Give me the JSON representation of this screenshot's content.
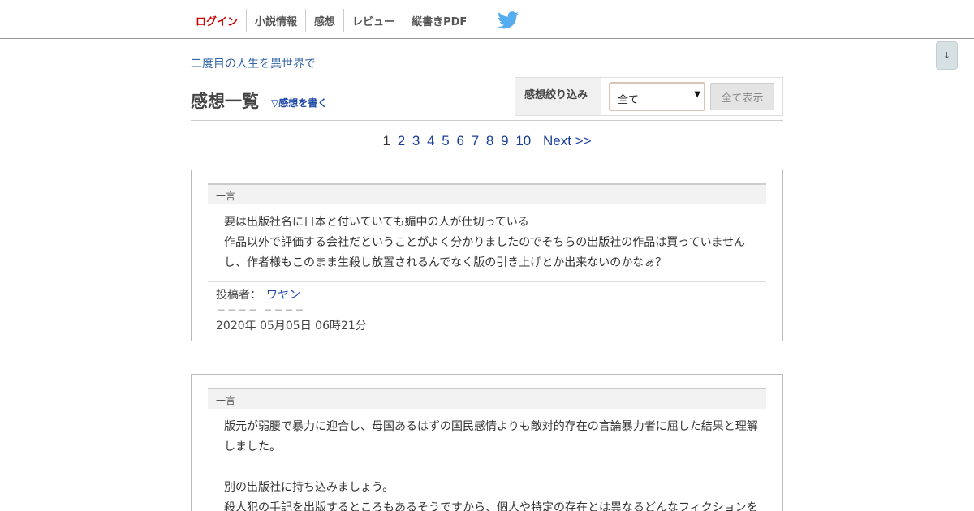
{
  "nav": {
    "items": [
      {
        "label": "ログイン",
        "kind": "login"
      },
      {
        "label": "小説情報"
      },
      {
        "label": "感想"
      },
      {
        "label": "レビュー"
      },
      {
        "label": "縦書きPDF"
      }
    ],
    "twitter_icon": "twitter-bird-icon",
    "twitter_color": "#55acee"
  },
  "scroll_button": {
    "label": "↓"
  },
  "novel_title": "二度目の人生を異世界で",
  "page": {
    "heading": "感想一覧",
    "write_link": "▽感想を書く"
  },
  "filter": {
    "label": "感想絞り込み",
    "selected": "全て",
    "button": "全て表示"
  },
  "pager": {
    "pages": [
      "1",
      "2",
      "3",
      "4",
      "5",
      "6",
      "7",
      "8",
      "9",
      "10"
    ],
    "current": "1",
    "next": "Next >>"
  },
  "comments": [
    {
      "head": "一言",
      "lines": [
        "要は出版社名に日本と付いていても媚中の人が仕切っている",
        "作品以外で評価する会社だということがよく分かりましたのでそちらの出版社の作品は買っていません",
        "し、作者様もこのまま生殺し放置されるんでなく版の引き上げとか出来ないのかなぁ？"
      ],
      "author_label": "投稿者：",
      "author": "ワヤン",
      "dashes": "－－－－ －－－－",
      "date": "2020年 05月05日 06時21分"
    },
    {
      "head": "一言",
      "lines": [
        "版元が弱腰で暴力に迎合し、母国あるはずの国民感情よりも敵対的存在の言論暴力者に屈した結果と理解",
        "しました。",
        "",
        "別の出版社に持ち込みましょう。",
        "殺人犯の手記を出版するところもあるそうですから、個人や特定の存在とは異なるどんなフィクションを"
      ]
    }
  ]
}
